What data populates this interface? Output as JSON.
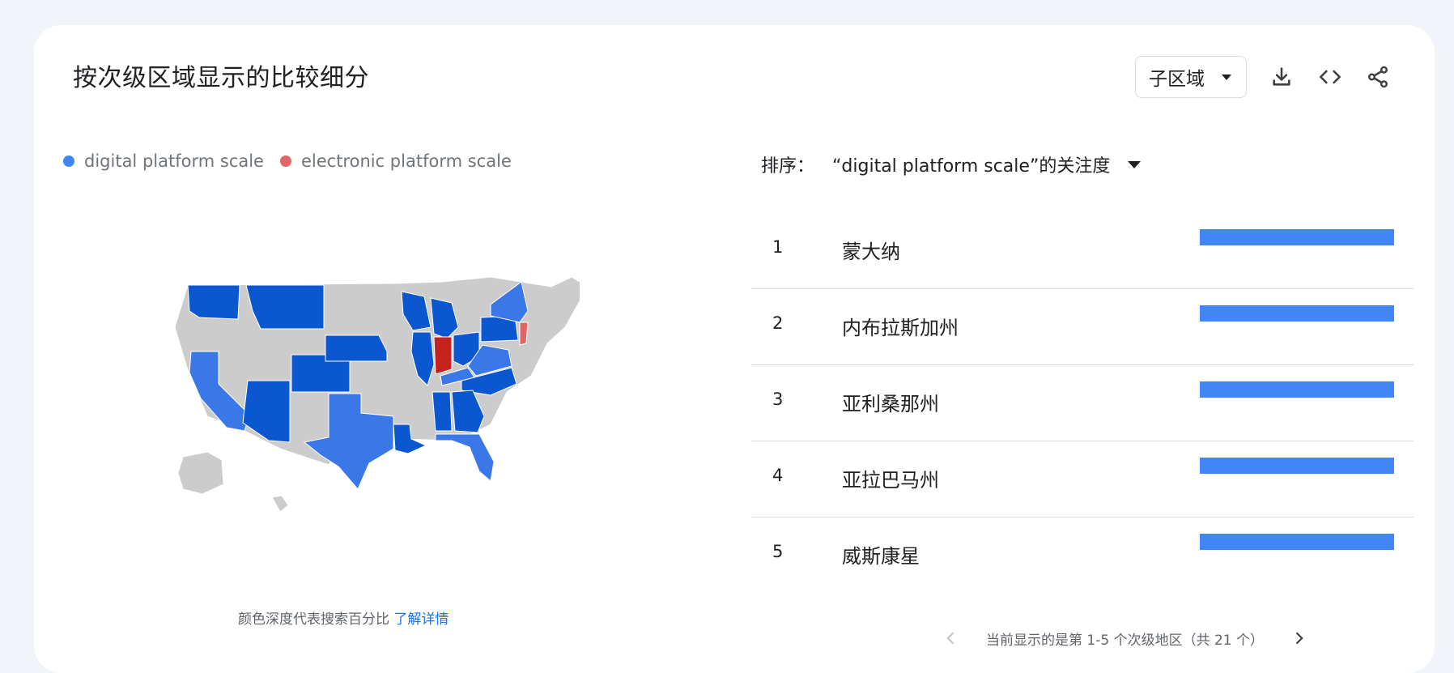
{
  "header": {
    "title": "按次级区域显示的比较细分",
    "region_select": "子区域",
    "icons": [
      "download-icon",
      "embed-code-icon",
      "share-icon"
    ]
  },
  "legend": {
    "items": [
      {
        "label": "digital platform scale",
        "color": "#4285f4"
      },
      {
        "label": "electronic platform scale",
        "color": "#e06666"
      }
    ]
  },
  "map": {
    "note_text": "颜色深度代表搜索百分比",
    "note_link": "了解详情"
  },
  "ranking": {
    "sort_label": "排序：",
    "sort_value": "“digital platform scale”的关注度",
    "rows": [
      {
        "rank": "1",
        "name": "蒙大纳",
        "value": 100
      },
      {
        "rank": "2",
        "name": "内布拉斯加州",
        "value": 100
      },
      {
        "rank": "3",
        "name": "亚利桑那州",
        "value": 100
      },
      {
        "rank": "4",
        "name": "亚拉巴马州",
        "value": 100
      },
      {
        "rank": "5",
        "name": "威斯康星",
        "value": 100
      }
    ]
  },
  "pager": {
    "label": "当前显示的是第 1-5 个次级地区（共 21 个）"
  },
  "colors": {
    "dark_blue": "#0b57d0",
    "mid_blue": "#3b78e7",
    "red": "#c5221f",
    "light_red": "#e06666",
    "no_data": "#cccccc"
  }
}
